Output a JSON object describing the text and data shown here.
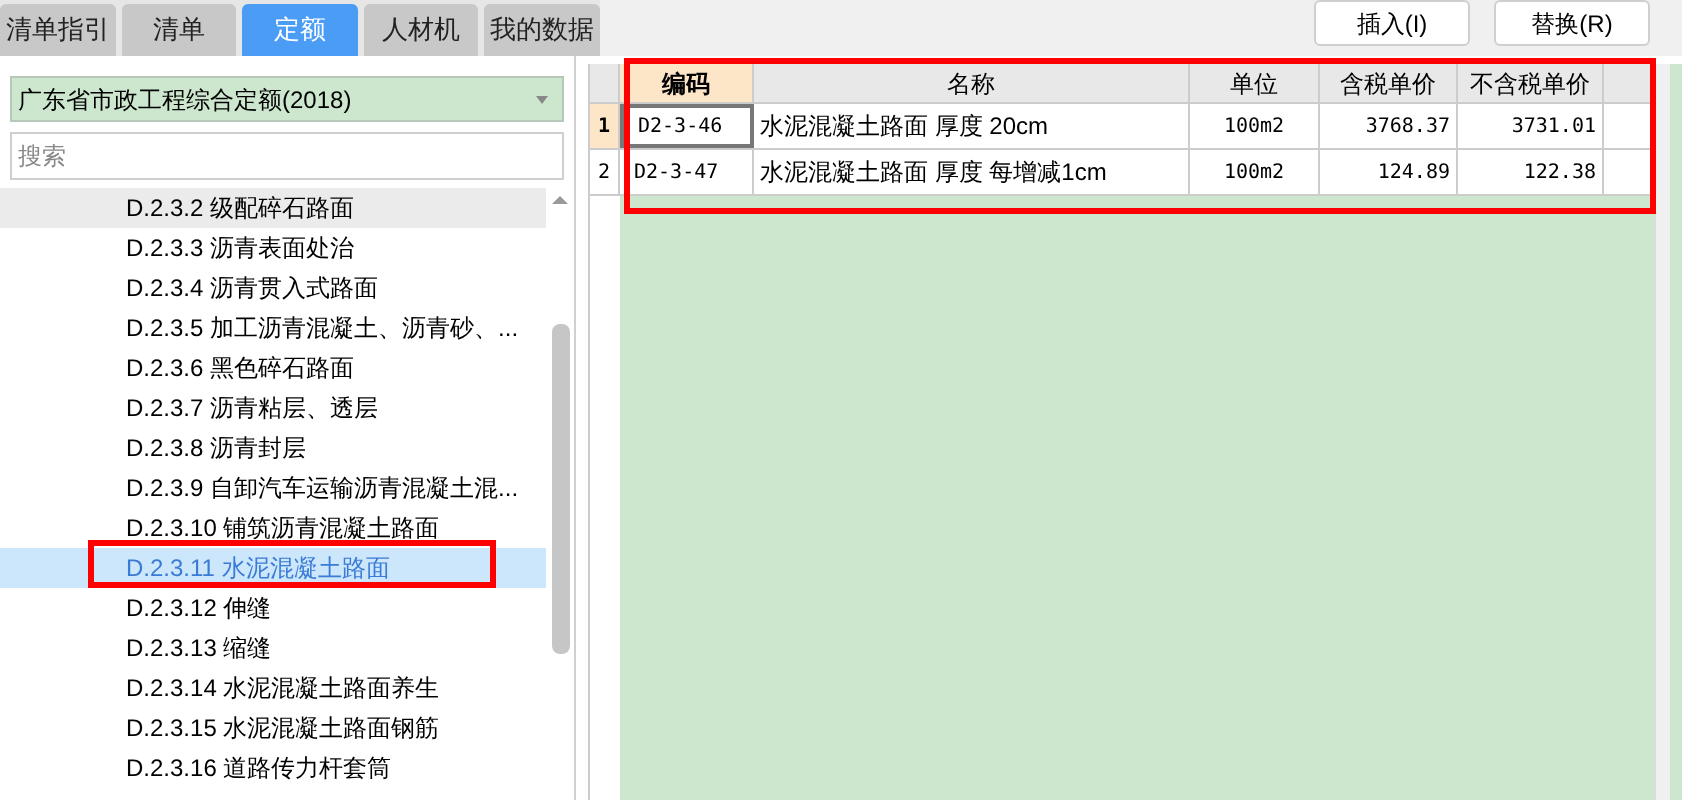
{
  "tabs": [
    {
      "label": "清单指引",
      "selected": false
    },
    {
      "label": "清单",
      "selected": false
    },
    {
      "label": "定额",
      "selected": true
    },
    {
      "label": "人材机",
      "selected": false
    },
    {
      "label": "我的数据",
      "selected": false
    }
  ],
  "quota_select": {
    "value": "广东省市政工程综合定额(2018)"
  },
  "search": {
    "placeholder": "搜索"
  },
  "tree": [
    {
      "label": "D.2.3.2 级配碎石路面",
      "hovered": true,
      "selected": false
    },
    {
      "label": "D.2.3.3 沥青表面处治",
      "hovered": false,
      "selected": false
    },
    {
      "label": "D.2.3.4 沥青贯入式路面",
      "hovered": false,
      "selected": false
    },
    {
      "label": "D.2.3.5 加工沥青混凝土、沥青砂、...",
      "hovered": false,
      "selected": false
    },
    {
      "label": "D.2.3.6 黑色碎石路面",
      "hovered": false,
      "selected": false
    },
    {
      "label": "D.2.3.7 沥青粘层、透层",
      "hovered": false,
      "selected": false
    },
    {
      "label": "D.2.3.8 沥青封层",
      "hovered": false,
      "selected": false
    },
    {
      "label": "D.2.3.9 自卸汽车运输沥青混凝土混...",
      "hovered": false,
      "selected": false
    },
    {
      "label": "D.2.3.10 铺筑沥青混凝土路面",
      "hovered": false,
      "selected": false
    },
    {
      "label": "D.2.3.11 水泥混凝土路面",
      "hovered": false,
      "selected": true
    },
    {
      "label": "D.2.3.12 伸缝",
      "hovered": false,
      "selected": false
    },
    {
      "label": "D.2.3.13 缩缝",
      "hovered": false,
      "selected": false
    },
    {
      "label": "D.2.3.14 水泥混凝土路面养生",
      "hovered": false,
      "selected": false
    },
    {
      "label": "D.2.3.15 水泥混凝土路面钢筋",
      "hovered": false,
      "selected": false
    },
    {
      "label": "D.2.3.16 道路传力杆套筒",
      "hovered": false,
      "selected": false
    }
  ],
  "buttons": [
    "插入(I)",
    "替换(R)"
  ],
  "table": {
    "columns": [
      "编码",
      "名称",
      "单位",
      "含税单价",
      "不含税单价"
    ],
    "rows": [
      {
        "number": "1",
        "selected": true,
        "cells": [
          "D2-3-46",
          "水泥混凝土路面 厚度 20cm",
          "100m2",
          "3768.37",
          "3731.01"
        ]
      },
      {
        "number": "2",
        "selected": false,
        "cells": [
          "D2-3-47",
          "水泥混凝土路面 厚度 每增减1cm",
          "100m2",
          "124.89",
          "122.38"
        ]
      }
    ]
  }
}
